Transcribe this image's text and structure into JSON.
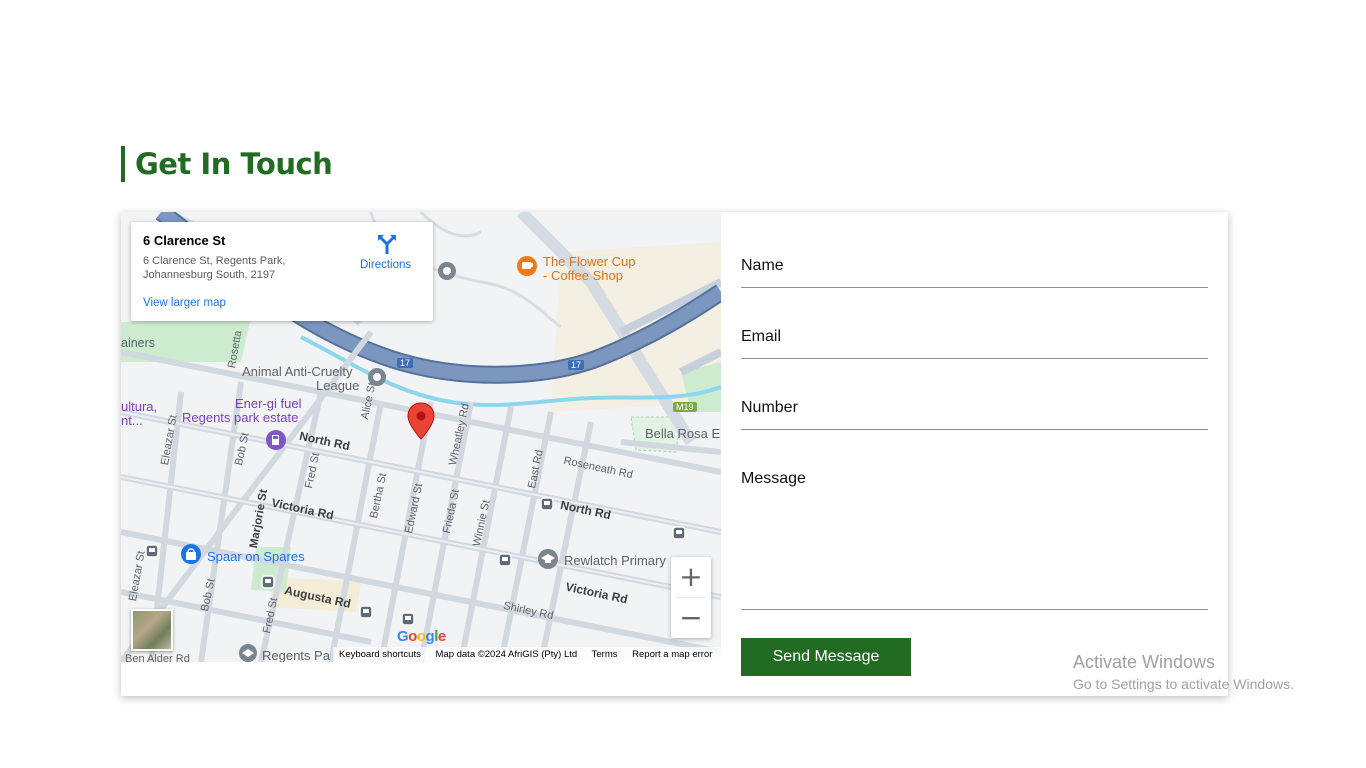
{
  "section": {
    "title": "Get In Touch"
  },
  "map": {
    "info": {
      "title": "6 Clarence St",
      "address_line1": "6 Clarence St, Regents Park,",
      "address_line2": "Johannesburg South, 2197",
      "directions_label": "Directions",
      "larger_map_label": "View larger map"
    },
    "labels": {
      "flower_cup_1": "The Flower Cup",
      "flower_cup_2": "- Coffee Shop",
      "animal_1": "Animal Anti-Cruelty",
      "animal_2": "League",
      "energi_1": "Ener-gi fuel",
      "energi_2": "Regents park estate",
      "cultura_1": "ultura,",
      "cultura_2": "nt...",
      "ainers": "ainers",
      "bella_rosa": "Bella Rosa E",
      "spaar": "Spaar on Spares",
      "rewlatch": "Rewlatch Primary",
      "regents_pa": "Regents Pa",
      "ben_alder": "Ben Alder Rd",
      "north_rd_1": "North Rd",
      "north_rd_2": "North Rd",
      "victoria_rd_1": "Victoria Rd",
      "victoria_rd_2": "Victoria Rd",
      "augusta_rd": "Augusta Rd",
      "roseneath_rd": "Roseneath Rd",
      "shirley_rd": "Shirley Rd",
      "alice_st": "Alice St",
      "wheatley_rd": "Wheatley Rd",
      "eleazar_st_1": "Eleazar St",
      "eleazar_st_2": "Eleazar St",
      "bob_st_1": "Bob St",
      "bob_st_2": "Bob St",
      "fred_st_1": "Fred St",
      "fred_st_2": "Fred St",
      "bertha_st": "Bertha St",
      "edward_st": "Edward St",
      "frieda_st": "Frieda St",
      "winnie_st": "Winnie St",
      "east_rd": "East Rd",
      "marjorie_st": "Marjorie St",
      "rosetta": "Rosetta",
      "rd": "Rd",
      "hwy_17_1": "17",
      "hwy_17_2": "17",
      "m19": "M19"
    },
    "zoom_in": "+",
    "zoom_out": "−",
    "google": "Google",
    "attribution": {
      "shortcuts": "Keyboard shortcuts",
      "data": "Map data ©2024 AfriGIS (Pty) Ltd",
      "terms": "Terms",
      "report": "Report a map error"
    }
  },
  "form": {
    "name_label": "Name",
    "email_label": "Email",
    "number_label": "Number",
    "message_label": "Message",
    "send_label": "Send Message"
  },
  "watermark": {
    "line1": "Activate Windows",
    "line2": "Go to Settings to activate Windows."
  },
  "colors": {
    "accent": "#226b22",
    "link": "#1a73e8",
    "highway": "#6d8bb5"
  }
}
